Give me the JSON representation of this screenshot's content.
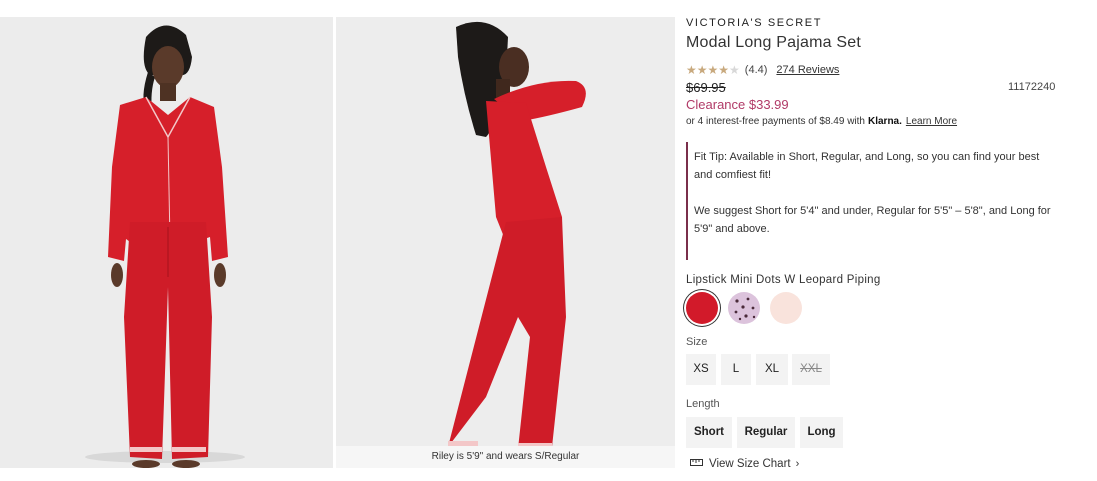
{
  "gallery": {
    "caption": "Riley is 5'9\" and wears S/Regular"
  },
  "product": {
    "brand": "VICTORIA'S SECRET",
    "title": "Modal Long Pajama Set",
    "rating": 4.4,
    "rating_text": "(4.4)",
    "reviews_link": "274 Reviews",
    "original_price": "$69.95",
    "clearance_price": "Clearance $33.99",
    "sku": "11172240",
    "klarna": {
      "text": "or 4 interest-free payments of $8.49 with",
      "logo": "Klarna.",
      "learn_more": "Learn More"
    },
    "fit_tip": {
      "line1": "Fit Tip: Available in Short, Regular, and Long, so you can find your best and comfiest fit!",
      "line2": "We suggest Short for 5'4\" and under, Regular for 5'5\" – 5'8\", and Long for 5'9\" and above."
    },
    "color_name": "Lipstick Mini Dots W Leopard Piping",
    "swatches": [
      {
        "name": "Lipstick Mini Dots",
        "color": "#d21a2a",
        "selected": true
      },
      {
        "name": "Leopard print lilac",
        "color": "#dcc3dc",
        "selected": false
      },
      {
        "name": "Blush",
        "color": "#f9e3dc",
        "selected": false
      }
    ],
    "size_label": "Size",
    "sizes": [
      {
        "label": "XS",
        "available": true
      },
      {
        "label": "L",
        "available": true
      },
      {
        "label": "XL",
        "available": true
      },
      {
        "label": "XXL",
        "available": false
      }
    ],
    "length_label": "Length",
    "lengths": [
      "Short",
      "Regular",
      "Long"
    ],
    "size_chart_link": "View Size Chart",
    "accent_color": "#b13a67"
  }
}
